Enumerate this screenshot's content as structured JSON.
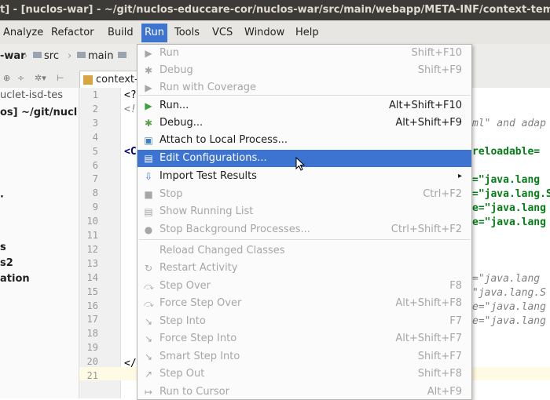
{
  "window": {
    "title": "t] - [nuclos-war] - ~/git/nuclos-educcare-cor/nuclos-war/src/main/webapp/META-INF/context-temp"
  },
  "menubar": [
    {
      "label": "Analyze",
      "active": false
    },
    {
      "label": "Refactor",
      "active": false
    },
    {
      "label": "Build",
      "active": false
    },
    {
      "label": "Run",
      "active": true
    },
    {
      "label": "Tools",
      "active": false
    },
    {
      "label": "VCS",
      "active": false
    },
    {
      "label": "Window",
      "active": false
    },
    {
      "label": "Help",
      "active": false
    }
  ],
  "breadcrumb": [
    "-war",
    "src",
    "main"
  ],
  "editor_tab": {
    "label": "context-"
  },
  "project_panel": {
    "lines": [
      "uclet-isd-tes",
      "os] ~/git/nucl",
      "",
      "",
      "",
      "",
      "s",
      "s2",
      "ation"
    ]
  },
  "gutter": {
    "line_numbers": [
      "1",
      "2",
      "3",
      "4",
      "5",
      "6",
      "7",
      "8",
      "9",
      "10",
      "11",
      "12",
      "13",
      "14",
      "15",
      "16",
      "17",
      "18",
      "19",
      "20",
      "21"
    ]
  },
  "code_fragments": [
    {
      "text": "<?",
      "style": "dark"
    },
    {
      "text": "<!",
      "style": "gray"
    },
    {
      "text": "ml\" and adap",
      "style": "gray"
    },
    {
      "text": "<C",
      "style": "blue"
    },
    {
      "text": "reloadable=",
      "style": "green"
    },
    {
      "text": "=\"java.lang",
      "style": "green"
    },
    {
      "text": "=\"java.lang.S",
      "style": "green"
    },
    {
      "text": "e=\"java.lang",
      "style": "green"
    },
    {
      "text": "e=\"java.lang",
      "style": "green"
    },
    {
      "text": "=\"java.lang",
      "style": "gray"
    },
    {
      "text": "\"java.lang.S",
      "style": "gray"
    },
    {
      "text": "e=\"java.lang",
      "style": "gray"
    },
    {
      "text": "e=\"java.lang",
      "style": "gray"
    },
    {
      "text": "</",
      "style": "dark"
    }
  ],
  "run_menu": {
    "items": [
      {
        "label": "Run",
        "shortcut": "Shift+F10",
        "enabled": false,
        "icon": "run-icon",
        "glyph": "▶"
      },
      {
        "label": "Debug",
        "shortcut": "Shift+F9",
        "enabled": false,
        "icon": "debug-icon",
        "glyph": "✱"
      },
      {
        "label": "Run with Coverage",
        "shortcut": "",
        "enabled": false,
        "icon": "coverage-icon",
        "glyph": "▶"
      },
      {
        "label": "Run...",
        "shortcut": "Alt+Shift+F10",
        "enabled": true,
        "icon": "run-icon",
        "glyph": "▶"
      },
      {
        "label": "Debug...",
        "shortcut": "Alt+Shift+F9",
        "enabled": true,
        "icon": "debug-icon",
        "glyph": "✱"
      },
      {
        "label": "Attach to Local Process...",
        "shortcut": "",
        "enabled": true,
        "icon": "attach-icon",
        "glyph": "▣"
      },
      {
        "label": "Edit Configurations...",
        "shortcut": "",
        "enabled": true,
        "selected": true,
        "icon": "edit-config-icon",
        "glyph": "▤"
      },
      {
        "label": "Import Test Results",
        "shortcut": "",
        "enabled": true,
        "submenu": true,
        "icon": "import-icon",
        "glyph": "⇩"
      },
      {
        "label": "Stop",
        "shortcut": "Ctrl+F2",
        "enabled": false,
        "icon": "stop-icon",
        "glyph": "■"
      },
      {
        "label": "Show Running List",
        "shortcut": "",
        "enabled": false,
        "icon": "list-icon",
        "glyph": "▤"
      },
      {
        "label": "Stop Background Processes...",
        "shortcut": "Ctrl+Shift+F2",
        "enabled": false,
        "icon": "stop-bg-icon",
        "glyph": "●"
      },
      {
        "label": "Reload Changed Classes",
        "shortcut": "",
        "enabled": false,
        "icon": "",
        "glyph": ""
      },
      {
        "label": "Restart Activity",
        "shortcut": "",
        "enabled": false,
        "icon": "restart-icon",
        "glyph": "↻"
      },
      {
        "label": "Step Over",
        "shortcut": "F8",
        "enabled": false,
        "icon": "step-over-icon",
        "glyph": "⤼"
      },
      {
        "label": "Force Step Over",
        "shortcut": "Alt+Shift+F8",
        "enabled": false,
        "icon": "force-step-over-icon",
        "glyph": "⤼"
      },
      {
        "label": "Step Into",
        "shortcut": "F7",
        "enabled": false,
        "icon": "step-into-icon",
        "glyph": "↘"
      },
      {
        "label": "Force Step Into",
        "shortcut": "Alt+Shift+F7",
        "enabled": false,
        "icon": "force-step-into-icon",
        "glyph": "↘"
      },
      {
        "label": "Smart Step Into",
        "shortcut": "Shift+F7",
        "enabled": false,
        "icon": "smart-step-into-icon",
        "glyph": "↘"
      },
      {
        "label": "Step Out",
        "shortcut": "Shift+F8",
        "enabled": false,
        "icon": "step-out-icon",
        "glyph": "↗"
      },
      {
        "label": "Run to Cursor",
        "shortcut": "Alt+F9",
        "enabled": false,
        "icon": "run-to-cursor-icon",
        "glyph": "↦"
      }
    ]
  },
  "colors": {
    "selection": "#3d73d1",
    "title_bg": "#3c3b37",
    "run_green": "#3ca33c",
    "debug_green": "#5aa246"
  }
}
